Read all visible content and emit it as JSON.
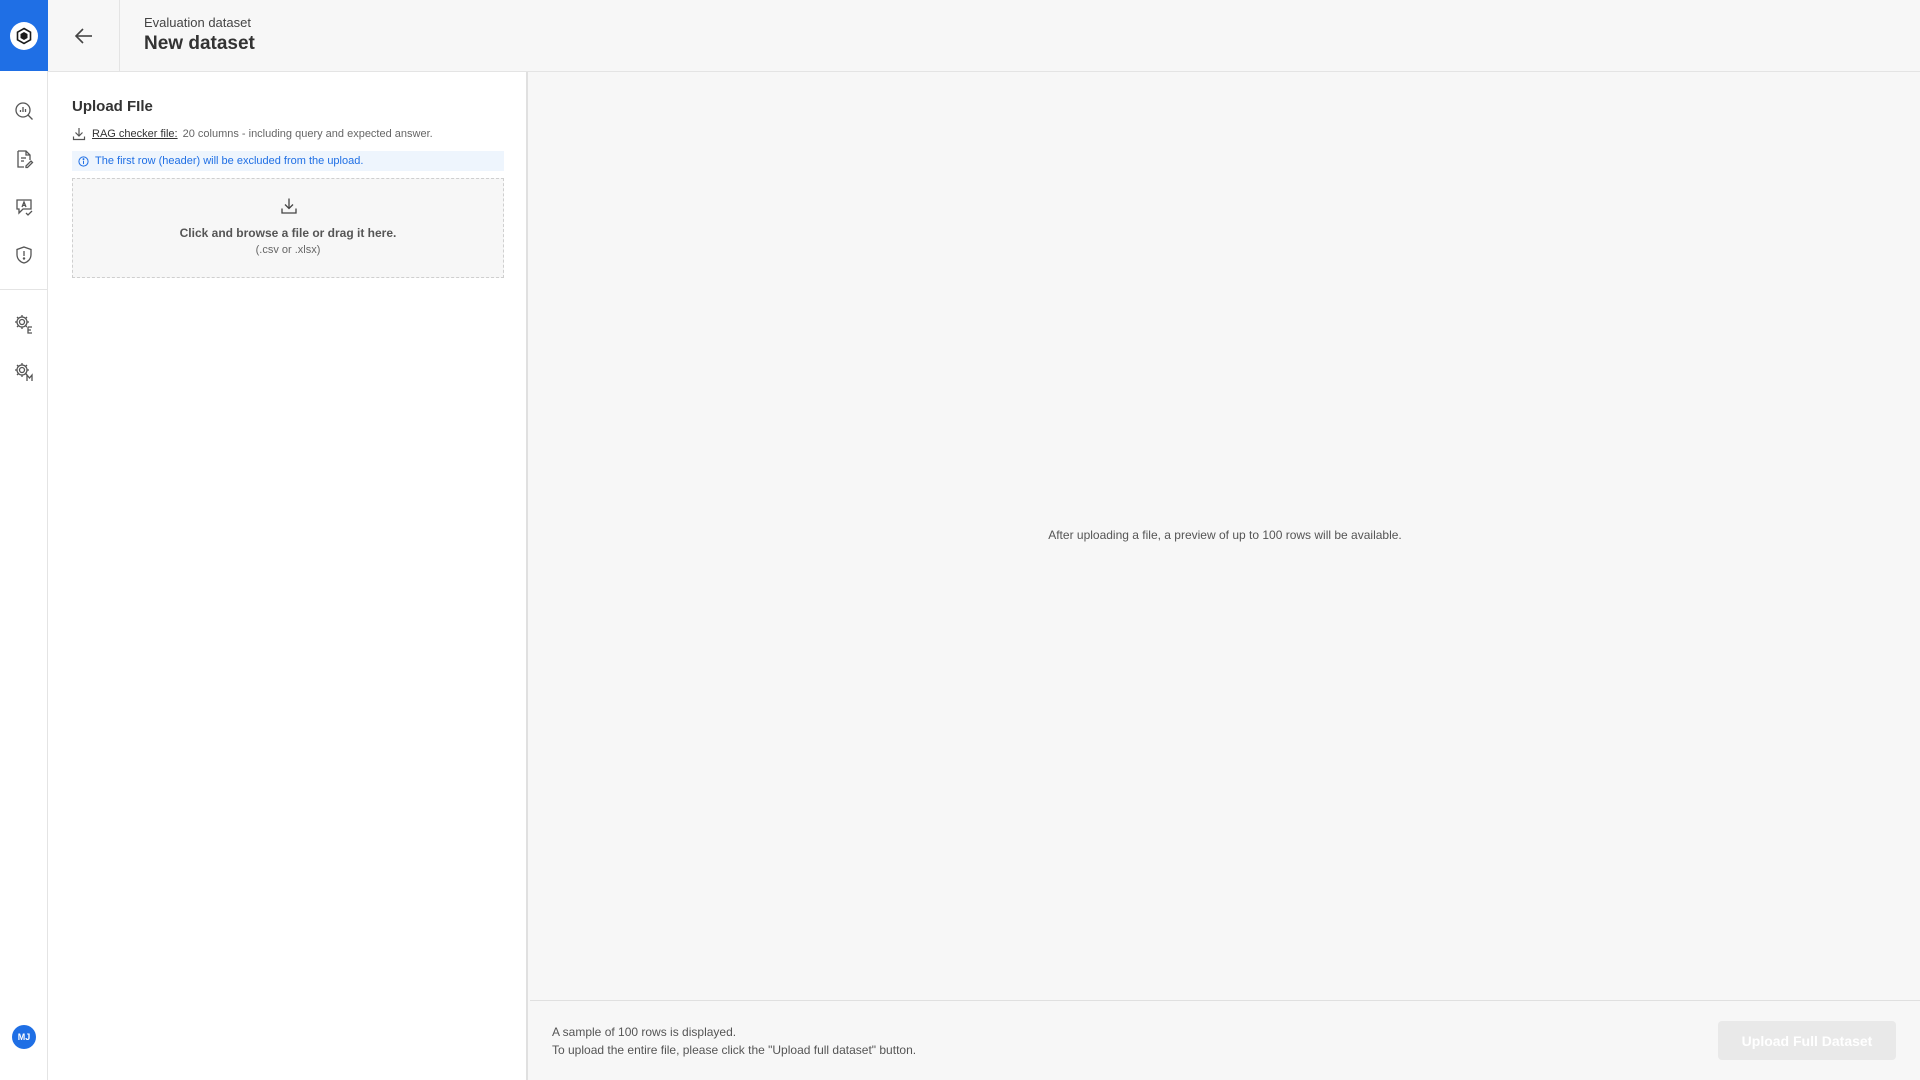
{
  "header": {
    "breadcrumb": "Evaluation dataset",
    "title": "New dataset"
  },
  "sidebar": {
    "items": [
      {
        "icon": "analytics-search-icon"
      },
      {
        "icon": "document-edit-icon"
      },
      {
        "icon": "text-check-icon"
      },
      {
        "icon": "shield-alert-icon"
      },
      {
        "icon": "settings-e-icon"
      },
      {
        "icon": "settings-m-icon"
      }
    ],
    "avatar_initials": "MJ"
  },
  "upload_panel": {
    "title": "Upload FIle",
    "checker_link": "RAG checker file:",
    "checker_desc": "20 columns - including query and expected answer.",
    "notice": "The first row (header) will be excluded from the upload.",
    "dropzone_main": "Click and browse a file or drag it here.",
    "dropzone_sub": "(.csv or .xlsx)"
  },
  "preview": {
    "empty_message": "After uploading a file, a preview of up to 100 rows will be available."
  },
  "footer": {
    "line1": "A sample of 100 rows is displayed.",
    "line2": "To upload the entire file, please click the \"Upload full dataset\" button.",
    "upload_button": "Upload Full Dataset"
  },
  "colors": {
    "accent": "#1f6fe5",
    "notice_bg": "#eef5fd",
    "disabled_button": "#e9e9e9"
  }
}
